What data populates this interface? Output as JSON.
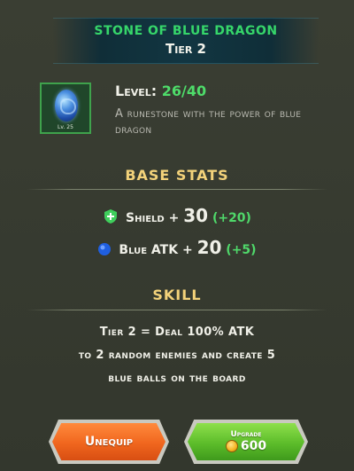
{
  "header": {
    "title": "Stone of Blue Dragon",
    "tier": "Tier 2"
  },
  "item": {
    "level_badge": "Lv. 25",
    "level_label": "Level:",
    "level_value": "26/40",
    "description": "A runestone with the power of blue dragon",
    "icon": "blue-dragon-runestone"
  },
  "base_stats": {
    "title": "BASE STATS",
    "stats": [
      {
        "label": "Shield",
        "operator": "+",
        "value": "30",
        "bonus": "(+20)",
        "icon": "shield-icon"
      },
      {
        "label": "Blue ATK",
        "operator": "+",
        "value": "20",
        "bonus": "(+5)",
        "icon": "blue-orb-icon"
      }
    ]
  },
  "skill": {
    "title": "SKILL",
    "lines": [
      "Tier 2 = Deal 100% ATK",
      "to 2 random enemies and create 5",
      "blue balls on the board"
    ]
  },
  "buttons": {
    "unequip": "Unequip",
    "upgrade_label": "Upgrade",
    "upgrade_cost": "600"
  },
  "colors": {
    "accent_green": "#4edc6a",
    "gold_title": "#f3d27a",
    "unequip_orange": "#f0661e",
    "upgrade_green": "#5cbc2a"
  }
}
